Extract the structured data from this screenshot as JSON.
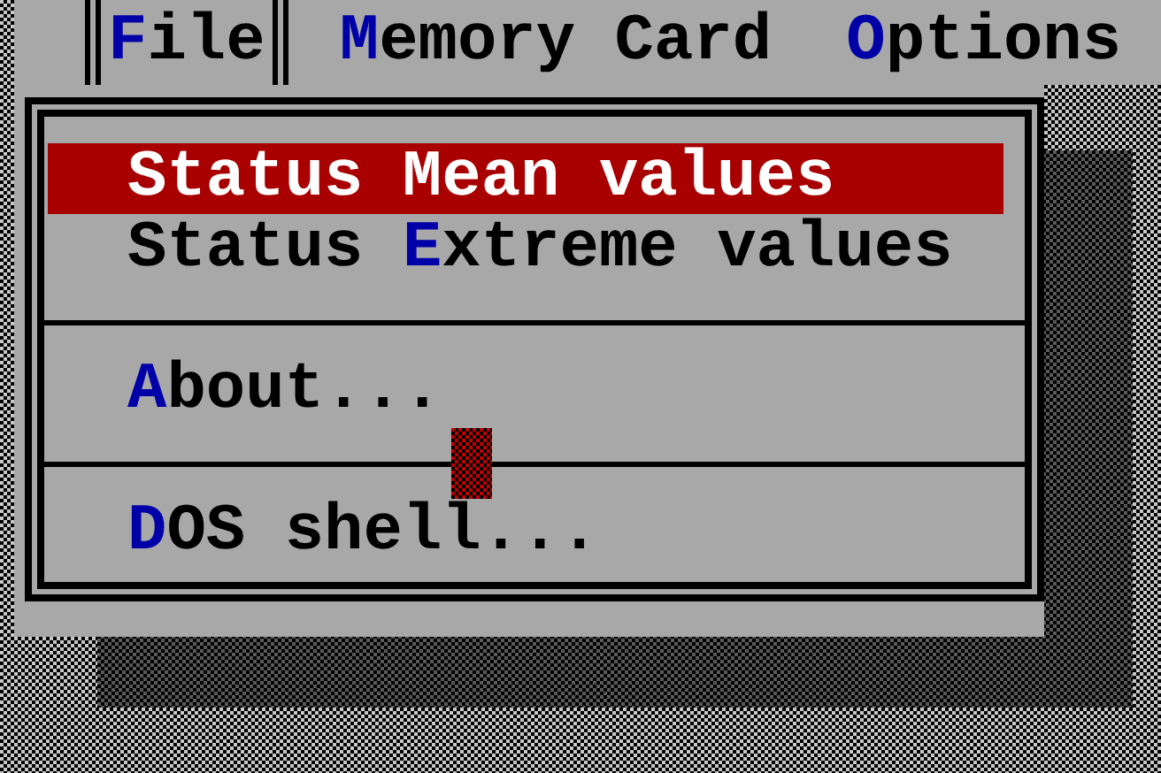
{
  "menu_bar": [
    {
      "label": "**F**ile",
      "selected": true
    },
    {
      "label": "**M**emory Card",
      "selected": false
    },
    {
      "label": "**O**ptions",
      "selected": false
    }
  ],
  "menu": {
    "items": [
      {
        "kind": "item",
        "label": "Status Mean values",
        "selected": true
      },
      {
        "kind": "item",
        "label": "Status **E**xtreme values",
        "selected": false
      },
      {
        "kind": "separator"
      },
      {
        "kind": "item",
        "label": "**A**bout...",
        "selected": false
      },
      {
        "kind": "separator"
      },
      {
        "kind": "item",
        "label": "**D**OS shell...",
        "selected": false
      }
    ]
  }
}
